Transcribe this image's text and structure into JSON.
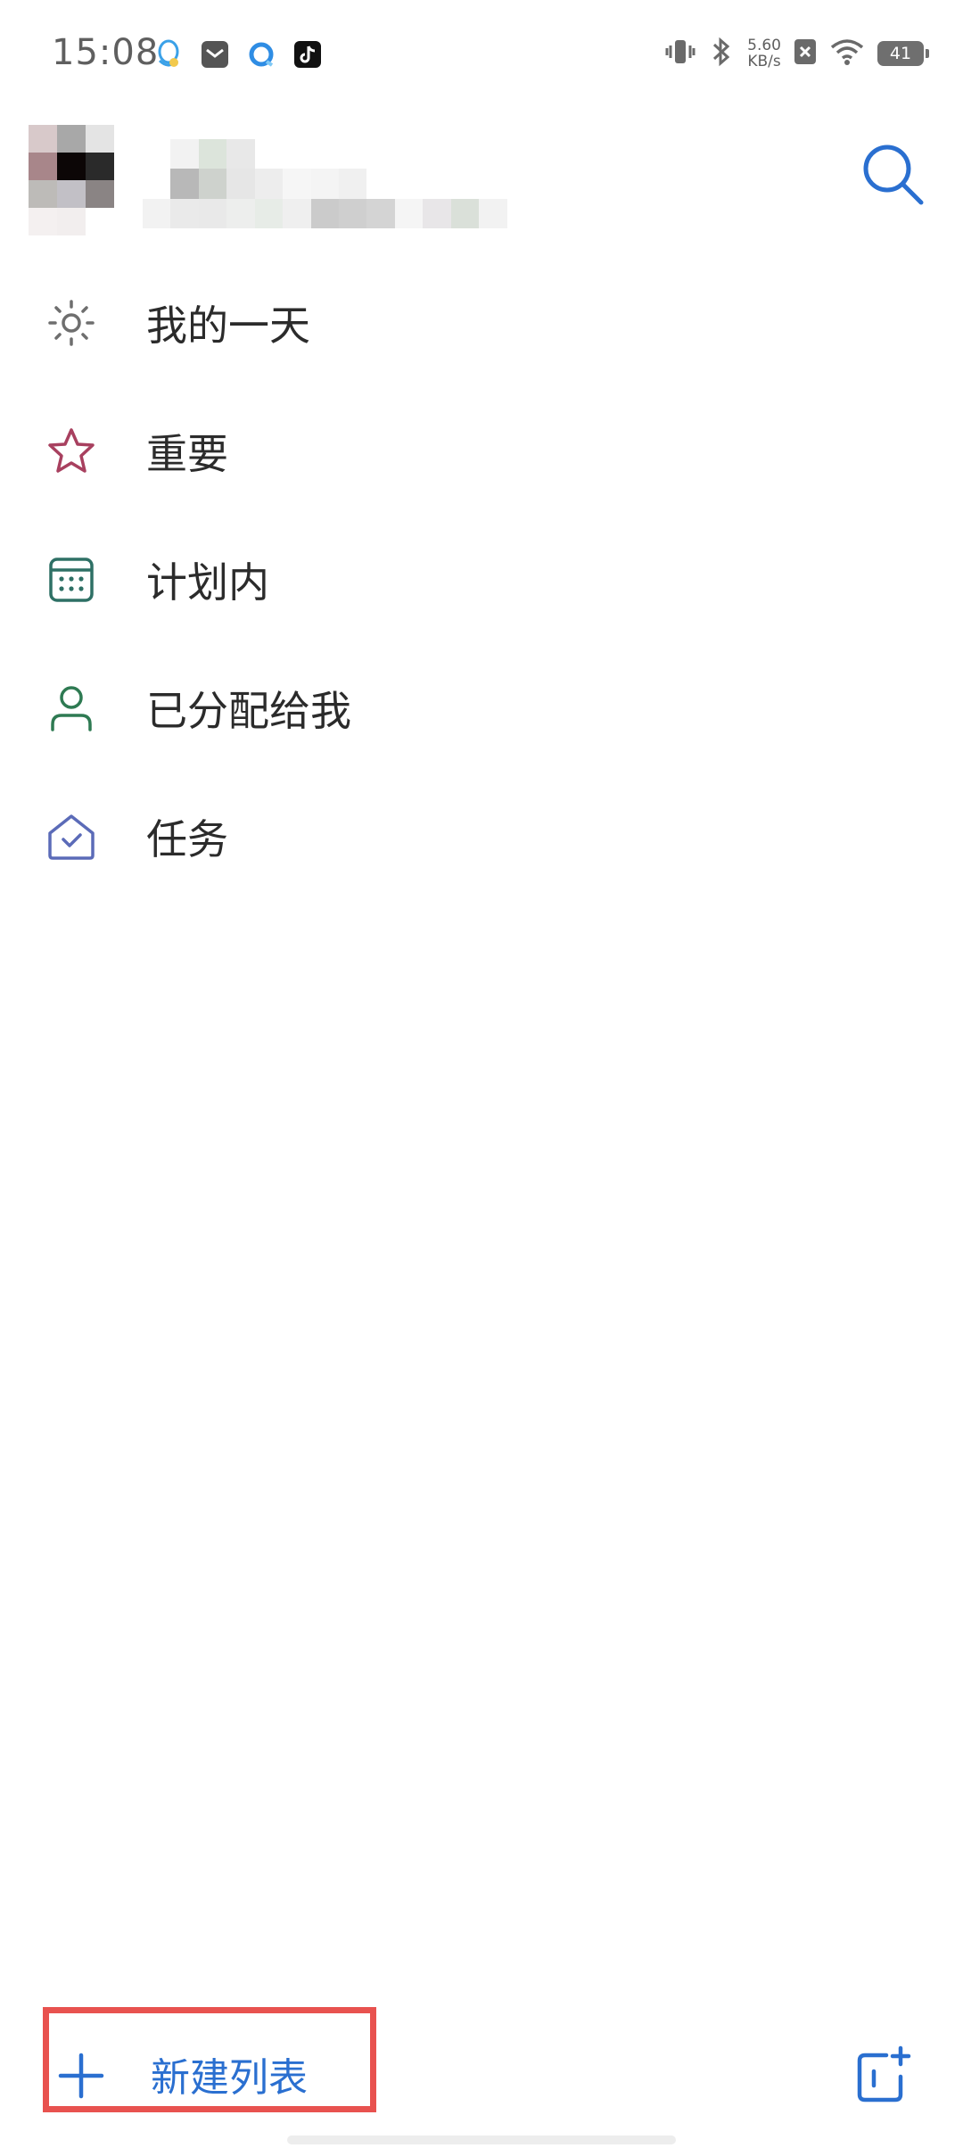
{
  "status_bar": {
    "time": "15:08",
    "net_speed_value": "5.60",
    "net_speed_unit": "KB/s",
    "battery_level": "41"
  },
  "account": {
    "name_redacted": true
  },
  "nav": {
    "items": [
      {
        "label": "我的一天",
        "icon": "sun-icon",
        "color": "#6e6e6e"
      },
      {
        "label": "重要",
        "icon": "star-icon",
        "color": "#a8405f"
      },
      {
        "label": "计划内",
        "icon": "calendar-icon",
        "color": "#2e7065"
      },
      {
        "label": "已分配给我",
        "icon": "person-icon",
        "color": "#2e7a52"
      },
      {
        "label": "任务",
        "icon": "home-check-icon",
        "color": "#5b6bb8"
      }
    ]
  },
  "bottom_bar": {
    "new_list_label": "新建列表",
    "accent_color": "#2a6fd0",
    "highlight_color": "#e8524f"
  }
}
